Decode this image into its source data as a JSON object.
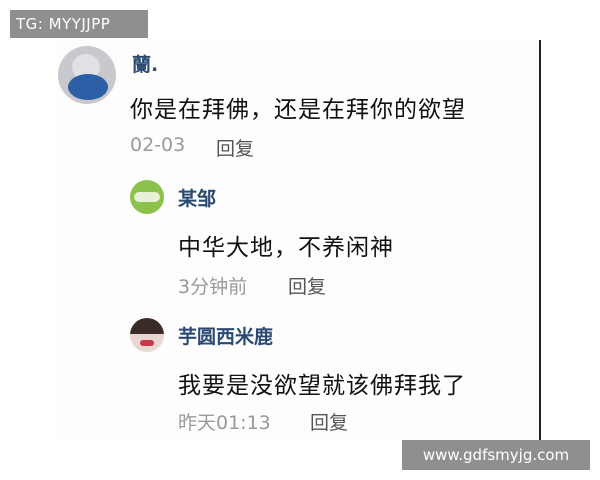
{
  "watermarks": {
    "top_left": "TG: MYYJJPP",
    "bottom_right": "www.gdfsmyjg.com"
  },
  "comments": {
    "main": {
      "username": "蘭.",
      "text": "你是在拜佛，还是在拜你的欲望",
      "date": "02-03",
      "reply_label": "回复",
      "avatar_icon": "user-avatar-icon"
    },
    "replies": [
      {
        "username": "某邹",
        "text": "中华大地，不养闲神",
        "date": "3分钟前",
        "reply_label": "回复",
        "avatar_icon": "user-avatar-icon"
      },
      {
        "username": "芋圆西米鹿",
        "text": "我要是没欲望就该佛拜我了",
        "date": "昨天01:13",
        "reply_label": "回复",
        "avatar_icon": "user-avatar-icon"
      }
    ]
  }
}
